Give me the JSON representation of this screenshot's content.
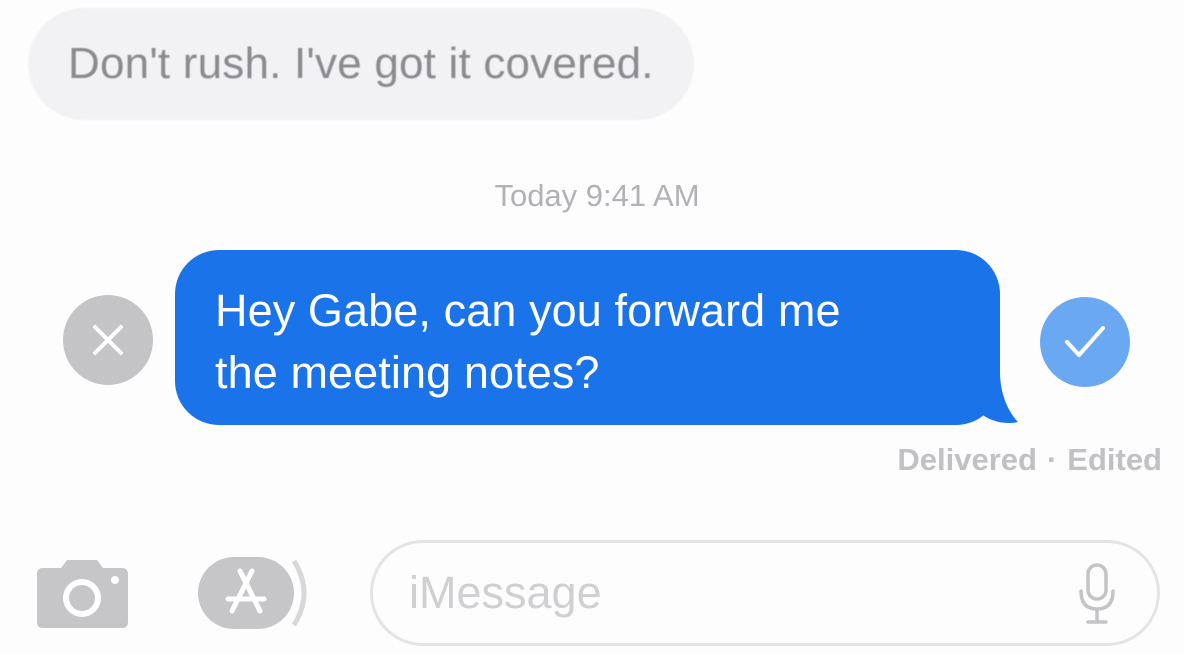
{
  "conversation": {
    "incoming_message": "Don't rush. I've got it covered.",
    "timestamp": "Today 9:41 AM",
    "editing_message": {
      "line1": "Hey Gabe, can you forward me",
      "line2": "the meeting notes?"
    },
    "status": {
      "delivered": "Delivered",
      "separator": "·",
      "edited": "Edited"
    }
  },
  "composer": {
    "placeholder": "iMessage",
    "value": ""
  },
  "icons": {
    "cancel": "close-icon",
    "confirm": "checkmark-icon",
    "camera": "camera-icon",
    "app_store": "app-store-icon",
    "microphone": "microphone-icon"
  },
  "colors": {
    "outgoing_bubble": "#1a73e8",
    "confirm_button": "#6aa9f2",
    "cancel_button": "#c4c4c6",
    "incoming_bubble": "#f2f2f4"
  }
}
